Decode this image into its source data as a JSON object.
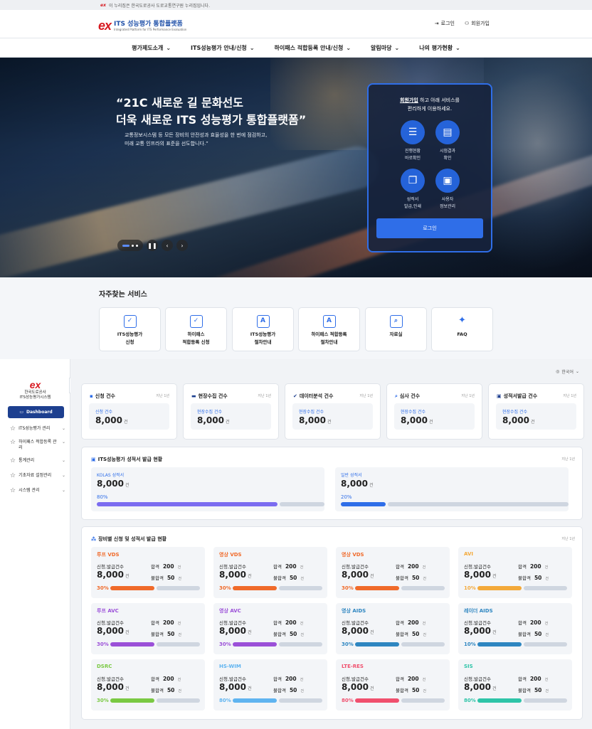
{
  "notice": {
    "text": "이 누리집은 한국도로공사 도로교통연구원 누리집입니다.",
    "logo": "ex"
  },
  "header": {
    "logo_mark": "ex",
    "title": "ITS 성능평가 통합플랫폼",
    "subtitle": "Integrated Platform for ITS Performance Evaluation",
    "login": "로그인",
    "signup": "회원가입"
  },
  "nav": [
    "평가제도소개",
    "ITS성능평가 안내/신청",
    "하이패스 적합등록 안내/신청",
    "알림마당",
    "나의 평가현황"
  ],
  "hero": {
    "line1": "“21C 새로운 길 문화선도",
    "line2": "더욱 새로운 ITS 성능평가 통합플랫폼”",
    "desc1": "교통정보시스템 등 모든 장비의 안전성과 효율성을 한 번에 점검하고,",
    "desc2": "미래 교통 인프라의 표준을 선도합니다.”"
  },
  "loginbox": {
    "msg_link": "회원가입",
    "msg_rest": " 하고 아래 서비스를",
    "msg2": "편리하게 이용하세요.",
    "services": [
      {
        "l1": "진행현황",
        "l2": "바로확인",
        "icon": "checklist-icon"
      },
      {
        "l1": "시험결과",
        "l2": "확인",
        "icon": "clipboard-icon"
      },
      {
        "l1": "성적서",
        "l2": "발급,인쇄",
        "icon": "documents-icon"
      },
      {
        "l1": "사용자",
        "l2": "정보관리",
        "icon": "id-card-icon"
      }
    ],
    "button": "로그인"
  },
  "freq": {
    "title": "자주찾는 서비스",
    "items": [
      {
        "l1": "ITS성능평가",
        "l2": "신청"
      },
      {
        "l1": "하이패스",
        "l2": "적합등록 신청"
      },
      {
        "l1": "ITS성능평가",
        "l2": "절차안내"
      },
      {
        "l1": "하이패스 적합등록",
        "l2": "절차안내"
      },
      {
        "l1": "자료실",
        "l2": ""
      },
      {
        "l1": "FAQ",
        "l2": ""
      }
    ]
  },
  "side": {
    "logo": "ex",
    "org": "한국도로공사",
    "sys": "ITS성능평가시스템",
    "dashboard": "Dashboard",
    "menu": [
      "ITS성능평가 관리",
      "하이패스 적합등록 관리",
      "통계관리",
      "기초자료 설정관리",
      "시스템 관리"
    ]
  },
  "main": {
    "lang": "한국어",
    "stats": [
      {
        "title": "신청 건수",
        "sub": "지난 1년",
        "label": "신청 건수",
        "value": "8,000",
        "unit": "건"
      },
      {
        "title": "현장수집 건수",
        "sub": "지난 1년",
        "label": "현장수집 건수",
        "value": "8,000",
        "unit": "건"
      },
      {
        "title": "데이터분석 건수",
        "sub": "지난 1년",
        "label": "현장수집 건수",
        "value": "8,000",
        "unit": "건"
      },
      {
        "title": "심사 건수",
        "sub": "지난 1년",
        "label": "현장수집 건수",
        "value": "8,000",
        "unit": "건"
      },
      {
        "title": "성적서발급 건수",
        "sub": "지난 1년",
        "label": "현장수집 건수",
        "value": "8,000",
        "unit": "건"
      }
    ],
    "issue": {
      "title": "ITS성능평가 성적서 발급 현황",
      "sub": "지난 1년",
      "items": [
        {
          "label": "KOLAS 성적서",
          "value": "8,000",
          "unit": "건",
          "pct": "80%",
          "ratio": 0.8,
          "color": "#7b6cf0"
        },
        {
          "label": "일반 성적서",
          "value": "8,000",
          "unit": "건",
          "pct": "20%",
          "ratio": 0.2,
          "color": "#2f6ee8"
        }
      ]
    },
    "equip": {
      "title": "장비별 신청 및 성적서 발급 현황",
      "sub": "지난 1년",
      "apply_label": "신청,발급건수",
      "pass_label": "합격",
      "fail_label": "불합격",
      "unit": "건",
      "items": [
        {
          "name": "루프 VDS",
          "color": "#f06a2a",
          "value": "8,000",
          "pass": "200",
          "fail": "50",
          "pct": "30%",
          "ratio": 0.5
        },
        {
          "name": "영상 VDS",
          "color": "#f06a2a",
          "value": "8,000",
          "pass": "200",
          "fail": "50",
          "pct": "30%",
          "ratio": 0.5
        },
        {
          "name": "영상 VDS",
          "color": "#f06a2a",
          "value": "8,000",
          "pass": "200",
          "fail": "50",
          "pct": "30%",
          "ratio": 0.5
        },
        {
          "name": "AVI",
          "color": "#f3a93a",
          "value": "8,000",
          "pass": "200",
          "fail": "50",
          "pct": "10%",
          "ratio": 0.5
        },
        {
          "name": "루프 AVC",
          "color": "#9b50d8",
          "value": "8,000",
          "pass": "200",
          "fail": "50",
          "pct": "30%",
          "ratio": 0.5
        },
        {
          "name": "영상 AVC",
          "color": "#9b50d8",
          "value": "8,000",
          "pass": "200",
          "fail": "50",
          "pct": "30%",
          "ratio": 0.5
        },
        {
          "name": "영상 AIDS",
          "color": "#2e86c1",
          "value": "8,000",
          "pass": "200",
          "fail": "50",
          "pct": "30%",
          "ratio": 0.5
        },
        {
          "name": "레이더 AIDS",
          "color": "#2e86c1",
          "value": "8,000",
          "pass": "200",
          "fail": "50",
          "pct": "10%",
          "ratio": 0.5
        },
        {
          "name": "DSRC",
          "color": "#7ac943",
          "value": "8,000",
          "pass": "200",
          "fail": "50",
          "pct": "30%",
          "ratio": 0.5
        },
        {
          "name": "HS-WIM",
          "color": "#5fb4f0",
          "value": "8,000",
          "pass": "200",
          "fail": "50",
          "pct": "80%",
          "ratio": 0.5
        },
        {
          "name": "LTE-RES",
          "color": "#f0506e",
          "value": "8,000",
          "pass": "200",
          "fail": "50",
          "pct": "80%",
          "ratio": 0.5
        },
        {
          "name": "SIS",
          "color": "#2ec4a8",
          "value": "8,000",
          "pass": "200",
          "fail": "50",
          "pct": "80%",
          "ratio": 0.5
        }
      ]
    }
  }
}
